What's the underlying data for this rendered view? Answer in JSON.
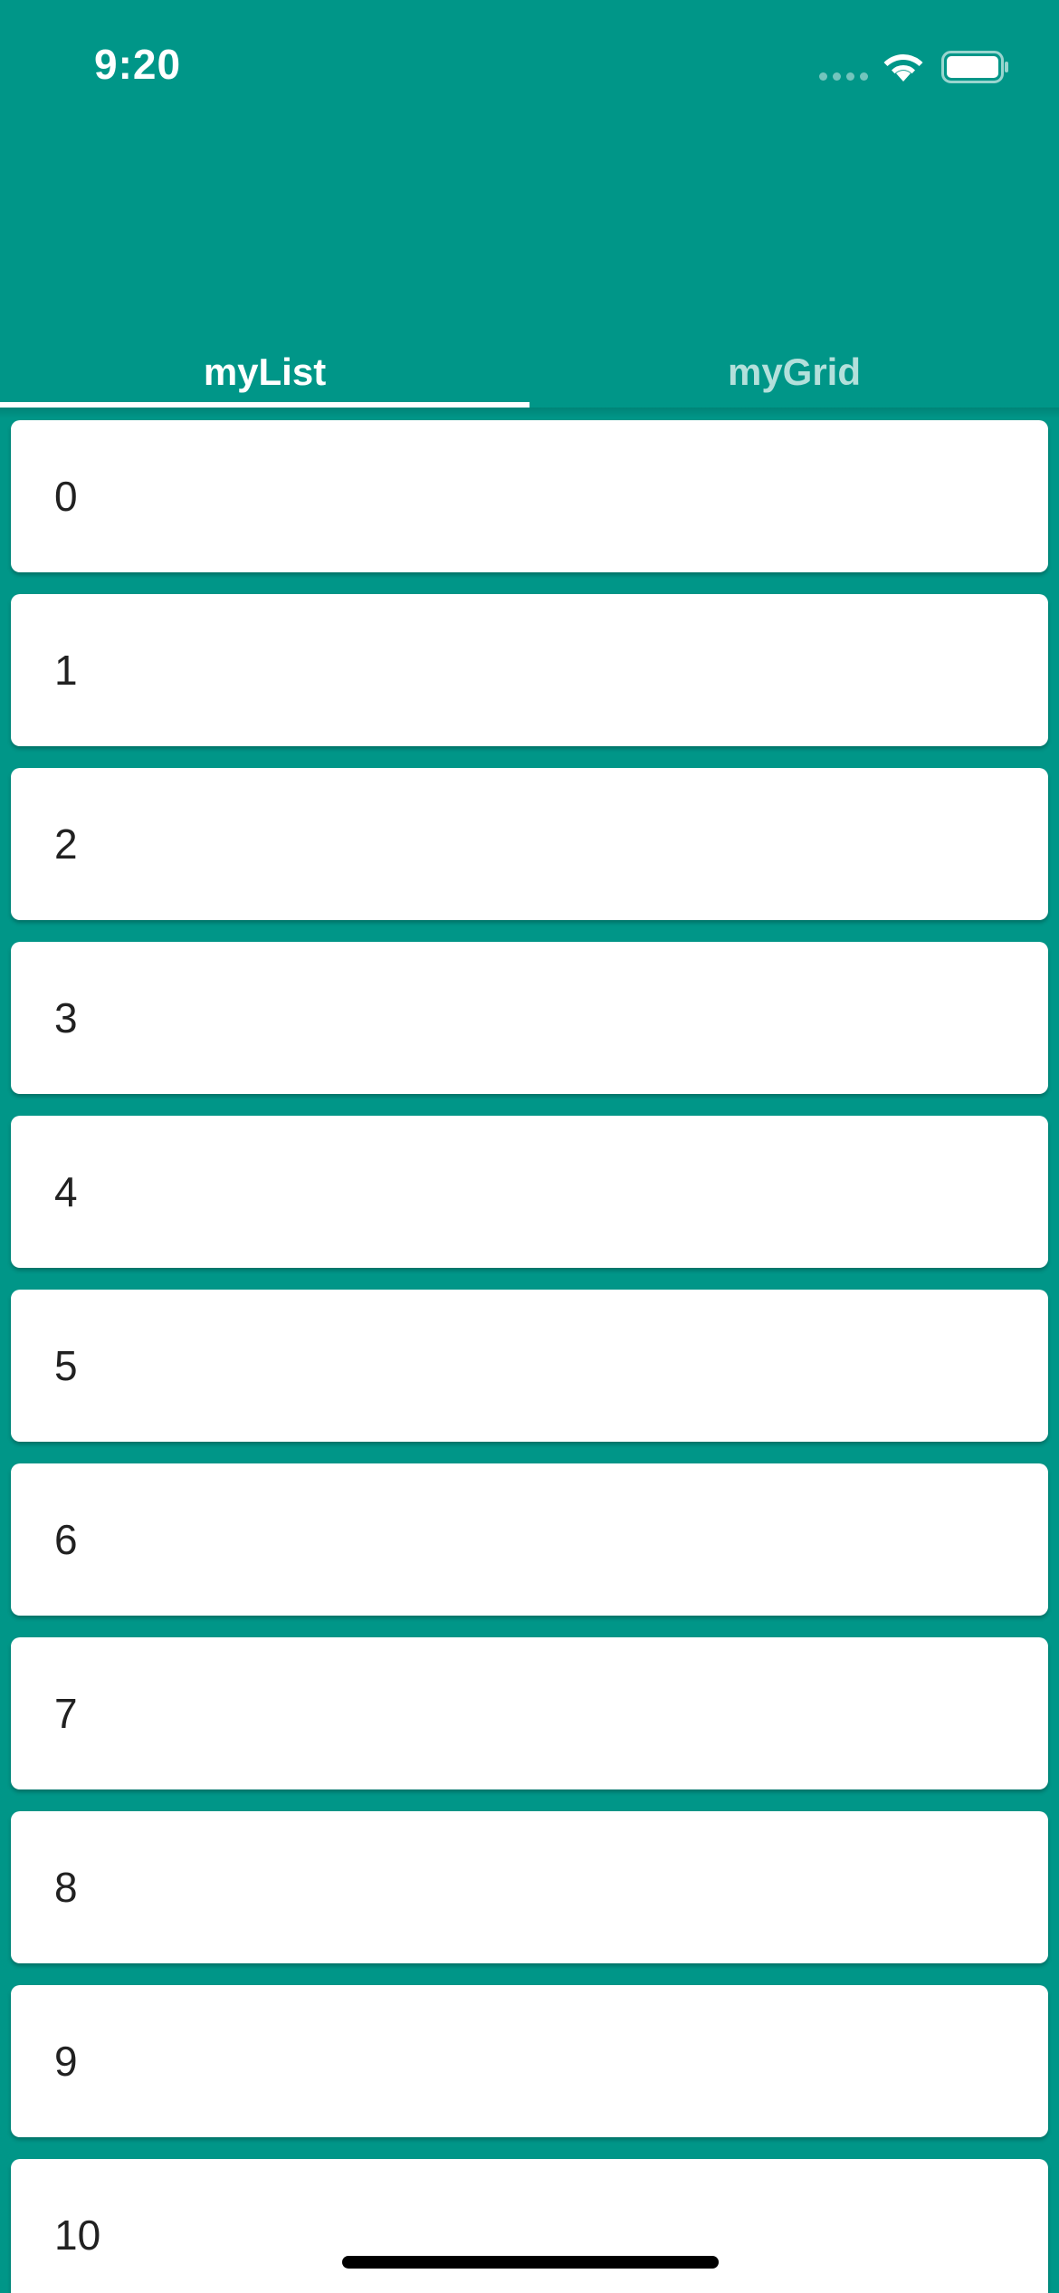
{
  "status_bar": {
    "time": "9:20",
    "icons": [
      "signal-dots-icon",
      "wifi-icon",
      "battery-icon"
    ]
  },
  "colors": {
    "primary": "#009688",
    "card": "#ffffff",
    "text": "#212121",
    "tab_active": "#ffffff",
    "tab_inactive": "rgba(255,255,255,0.7)"
  },
  "tabs": [
    {
      "label": "myList",
      "selected": true
    },
    {
      "label": "myGrid",
      "selected": false
    }
  ],
  "list": {
    "items": [
      "0",
      "1",
      "2",
      "3",
      "4",
      "5",
      "6",
      "7",
      "8",
      "9",
      "10"
    ]
  }
}
